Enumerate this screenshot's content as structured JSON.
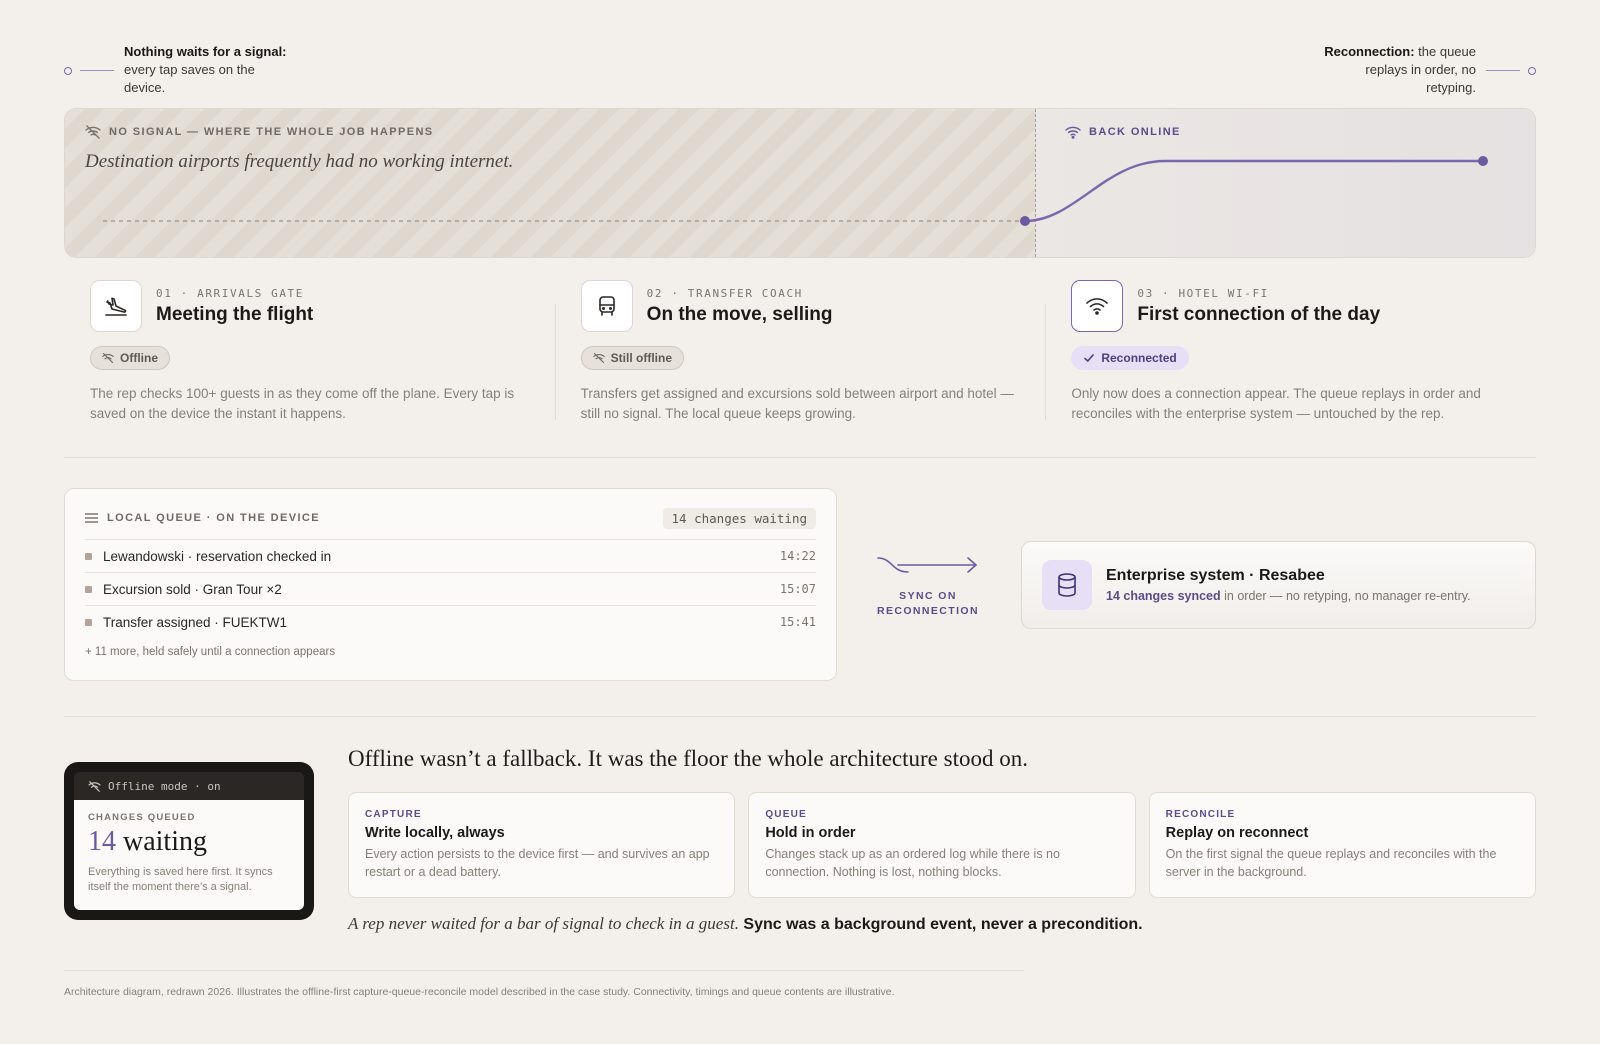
{
  "annotations": {
    "left": {
      "bold": "Nothing waits for a signal:",
      "text": "every tap saves on the device."
    },
    "right": {
      "bold": "Reconnection:",
      "text": "the queue replays in order, no retyping."
    }
  },
  "timeline": {
    "offline_label": "NO SIGNAL — WHERE THE WHOLE JOB HAPPENS",
    "offline_caption": "Destination airports frequently had no working internet.",
    "online_label": "BACK ONLINE",
    "accent_color": "#7a68ad"
  },
  "stages": [
    {
      "kicker": "01 · ARRIVALS GATE",
      "title": "Meeting the flight",
      "status": "Offline",
      "icon": "plane-landing-icon",
      "desc": "The rep checks 100+ guests in as they come off the plane. Every tap is saved on the device the instant it happens."
    },
    {
      "kicker": "02 · TRANSFER COACH",
      "title": "On the move, selling",
      "status": "Still offline",
      "icon": "bus-icon",
      "desc": "Transfers get assigned and excursions sold between airport and hotel — still no signal. The local queue keeps growing."
    },
    {
      "kicker": "03 · HOTEL WI-FI",
      "title": "First connection of the day",
      "status": "Reconnected",
      "icon": "wifi-icon",
      "desc": "Only now does a connection appear. The queue replays in order and reconciles with the enterprise system — untouched by the rep."
    }
  ],
  "queue": {
    "title": "LOCAL QUEUE · ON THE DEVICE",
    "badge": "14 changes waiting",
    "items": [
      {
        "label": "Lewandowski · reservation checked in",
        "time": "14:22"
      },
      {
        "label": "Excursion sold · Gran Tour ×2",
        "time": "15:07"
      },
      {
        "label": "Transfer assigned · FUEKTW1",
        "time": "15:41"
      }
    ],
    "more": "+ 11 more, held safely until a connection appears"
  },
  "sync": {
    "line1": "SYNC ON",
    "line2": "RECONNECTION"
  },
  "enterprise": {
    "title": "Enterprise system · Resabee",
    "synced": "14 changes synced",
    "rest": " in order — no retyping, no manager re-entry."
  },
  "device": {
    "bar": "Offline mode · on",
    "kicker": "CHANGES QUEUED",
    "count": "14",
    "word": " waiting",
    "note": "Everything is saved here first. It syncs itself the moment there’s a signal."
  },
  "headline": "Offline wasn’t a fallback. It was the floor the whole architecture stood on.",
  "cards": [
    {
      "kicker": "CAPTURE",
      "title": "Write locally, always",
      "desc": "Every action persists to the device first — and survives an app restart or a dead battery."
    },
    {
      "kicker": "QUEUE",
      "title": "Hold in order",
      "desc": "Changes stack up as an ordered log while there is no connection. Nothing is lost, nothing blocks."
    },
    {
      "kicker": "RECONCILE",
      "title": "Replay on reconnect",
      "desc": "On the first signal the queue replays and reconciles with the server in the background."
    }
  ],
  "tagline": {
    "italic": "A rep never waited for a bar of signal to check in a guest.",
    "bold": " Sync was a background event, never a precondition."
  },
  "footnote": "Architecture diagram, redrawn 2026. Illustrates the offline-first capture-queue-reconcile model described in the case study. Connectivity, timings and queue contents are illustrative."
}
